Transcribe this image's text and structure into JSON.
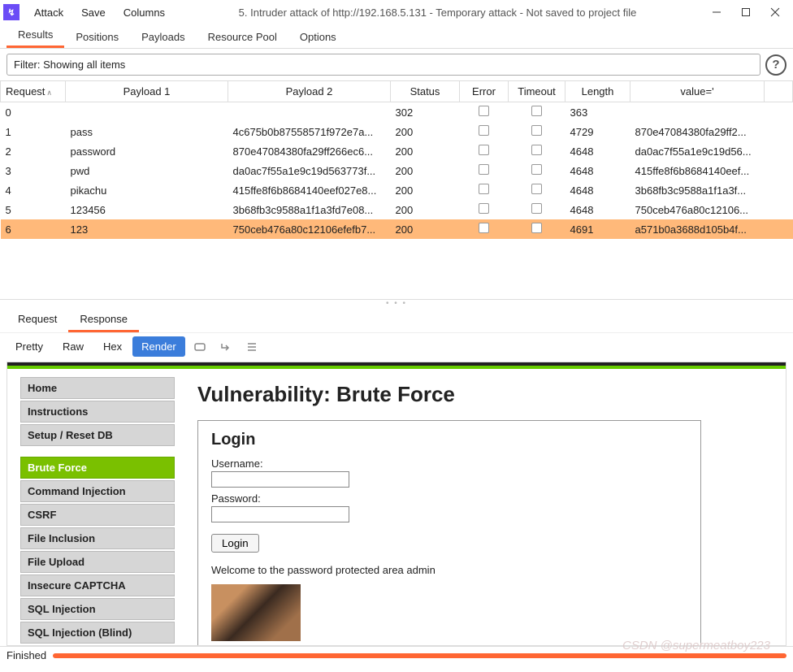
{
  "title": "5. Intruder attack of http://192.168.5.131 - Temporary attack - Not saved to project file",
  "menu": {
    "attack": "Attack",
    "save": "Save",
    "columns": "Columns"
  },
  "tabs": {
    "results": "Results",
    "positions": "Positions",
    "payloads": "Payloads",
    "pool": "Resource Pool",
    "options": "Options"
  },
  "filter": "Filter: Showing all items",
  "cols": {
    "request": "Request",
    "p1": "Payload 1",
    "p2": "Payload 2",
    "status": "Status",
    "error": "Error",
    "timeout": "Timeout",
    "length": "Length",
    "value": "value='"
  },
  "rows": [
    {
      "req": "0",
      "p1": "",
      "p2": "",
      "status": "302",
      "len": "363",
      "val": ""
    },
    {
      "req": "1",
      "p1": "pass",
      "p2": "4c675b0b87558571f972e7a...",
      "status": "200",
      "len": "4729",
      "val": "870e47084380fa29ff2..."
    },
    {
      "req": "2",
      "p1": "password",
      "p2": "870e47084380fa29ff266ec6...",
      "status": "200",
      "len": "4648",
      "val": "da0ac7f55a1e9c19d56..."
    },
    {
      "req": "3",
      "p1": "pwd",
      "p2": "da0ac7f55a1e9c19d563773f...",
      "status": "200",
      "len": "4648",
      "val": "415ffe8f6b8684140eef..."
    },
    {
      "req": "4",
      "p1": "pikachu",
      "p2": "415ffe8f6b8684140eef027e8...",
      "status": "200",
      "len": "4648",
      "val": "3b68fb3c9588a1f1a3f..."
    },
    {
      "req": "5",
      "p1": "123456",
      "p2": "3b68fb3c9588a1f1a3fd7e08...",
      "status": "200",
      "len": "4648",
      "val": "750ceb476a80c12106..."
    },
    {
      "req": "6",
      "p1": "123",
      "p2": "750ceb476a80c12106efefb7...",
      "status": "200",
      "len": "4691",
      "val": "a571b0a3688d105b4f..."
    }
  ],
  "selected_row": 6,
  "subtabs": {
    "request": "Request",
    "response": "Response"
  },
  "views": {
    "pretty": "Pretty",
    "raw": "Raw",
    "hex": "Hex",
    "render": "Render"
  },
  "dvwa": {
    "h1": "Vulnerability: Brute Force",
    "nav1": [
      "Home",
      "Instructions",
      "Setup / Reset DB"
    ],
    "nav2": [
      "Brute Force",
      "Command Injection",
      "CSRF",
      "File Inclusion",
      "File Upload",
      "Insecure CAPTCHA",
      "SQL Injection",
      "SQL Injection (Blind)"
    ],
    "active": "Brute Force",
    "login": {
      "title": "Login",
      "user": "Username:",
      "pass": "Password:",
      "btn": "Login"
    },
    "welcome": "Welcome to the password protected area admin"
  },
  "status": "Finished",
  "watermark": "CSDN @supermeatboy223"
}
